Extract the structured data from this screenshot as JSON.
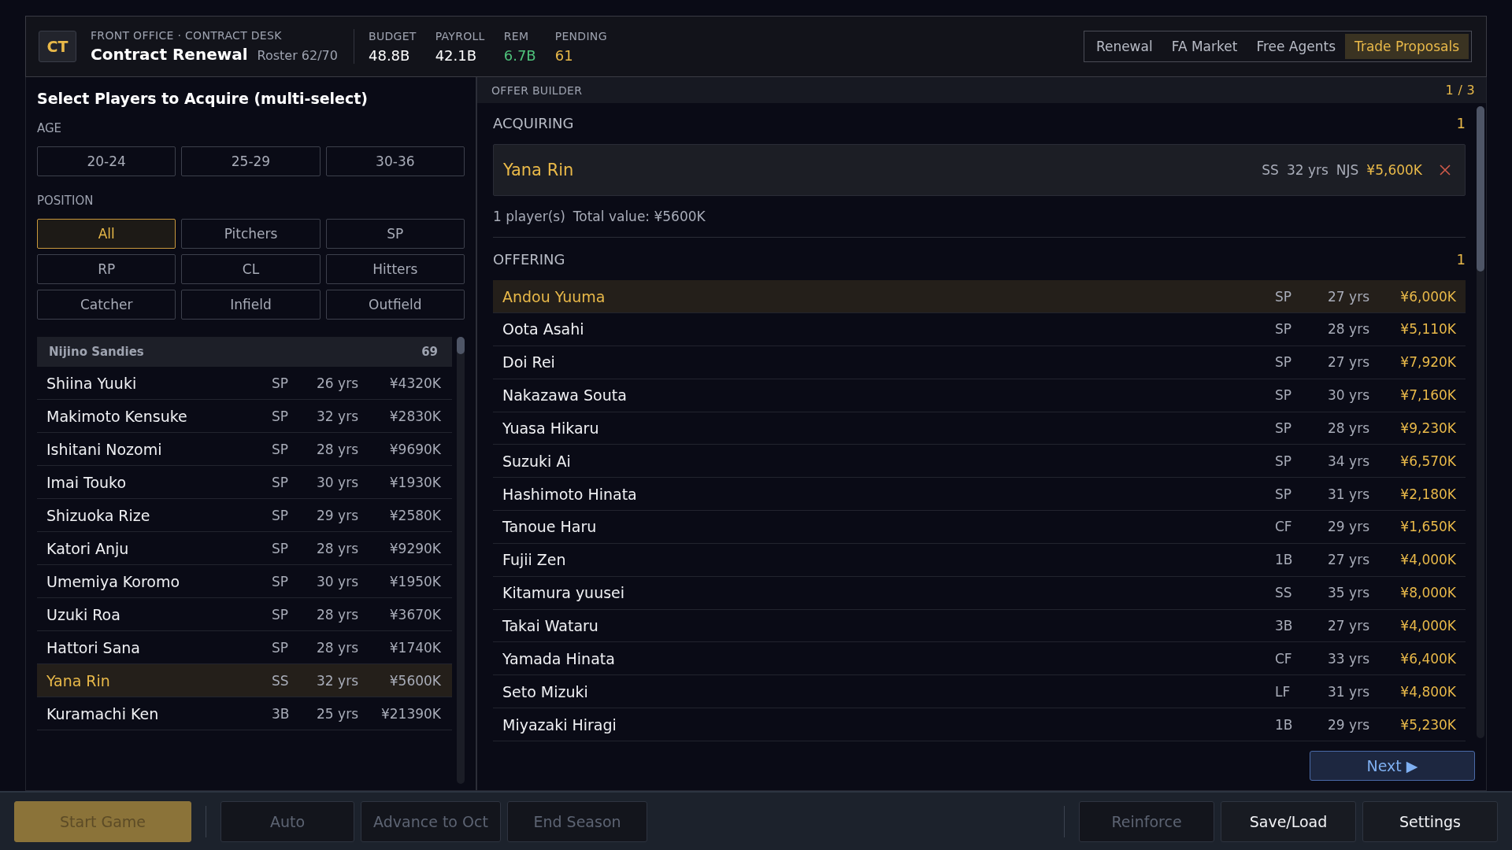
{
  "header": {
    "badge": "CT",
    "breadcrumb": "FRONT OFFICE · CONTRACT DESK",
    "title": "Contract Renewal",
    "roster": "Roster 62/70",
    "stats": [
      {
        "label": "BUDGET",
        "value": "48.8B",
        "color": "#ffffff"
      },
      {
        "label": "PAYROLL",
        "value": "42.1B",
        "color": "#ffffff"
      },
      {
        "label": "REM",
        "value": "6.7B",
        "color": "#4fc27b"
      },
      {
        "label": "PENDING",
        "value": "61",
        "color": "#e9b949"
      }
    ],
    "tabs": [
      {
        "label": "Renewal",
        "selected": false
      },
      {
        "label": "FA Market",
        "selected": false
      },
      {
        "label": "Free Agents",
        "selected": false
      },
      {
        "label": "Trade Proposals",
        "selected": true
      }
    ]
  },
  "selector": {
    "title": "Select Players to Acquire (multi-select)",
    "filters": [
      {
        "label": "AGE",
        "options": [
          {
            "label": "20-24",
            "selected": false
          },
          {
            "label": "25-29",
            "selected": false
          },
          {
            "label": "30-36",
            "selected": false
          }
        ]
      },
      {
        "label": "POSITION",
        "options": [
          {
            "label": "All",
            "selected": true
          },
          {
            "label": "Pitchers",
            "selected": false
          },
          {
            "label": "SP",
            "selected": false
          },
          {
            "label": "RP",
            "selected": false
          },
          {
            "label": "CL",
            "selected": false
          },
          {
            "label": "Hitters",
            "selected": false
          },
          {
            "label": "Catcher",
            "selected": false
          },
          {
            "label": "Infield",
            "selected": false
          },
          {
            "label": "Outfield",
            "selected": false
          }
        ]
      }
    ],
    "team": {
      "name": "Nijino Sandies",
      "count": "69"
    },
    "players": [
      {
        "name": "Shiina Yuuki",
        "pos": "SP",
        "age": "26 yrs",
        "value": "¥4320K",
        "selected": false
      },
      {
        "name": "Makimoto Kensuke",
        "pos": "SP",
        "age": "32 yrs",
        "value": "¥2830K",
        "selected": false
      },
      {
        "name": "Ishitani Nozomi",
        "pos": "SP",
        "age": "28 yrs",
        "value": "¥9690K",
        "selected": false
      },
      {
        "name": "Imai Touko",
        "pos": "SP",
        "age": "30 yrs",
        "value": "¥1930K",
        "selected": false
      },
      {
        "name": "Shizuoka Rize",
        "pos": "SP",
        "age": "29 yrs",
        "value": "¥2580K",
        "selected": false
      },
      {
        "name": "Katori Anju",
        "pos": "SP",
        "age": "28 yrs",
        "value": "¥9290K",
        "selected": false
      },
      {
        "name": "Umemiya Koromo",
        "pos": "SP",
        "age": "30 yrs",
        "value": "¥1950K",
        "selected": false
      },
      {
        "name": "Uzuki Roa",
        "pos": "SP",
        "age": "28 yrs",
        "value": "¥3670K",
        "selected": false
      },
      {
        "name": "Hattori Sana",
        "pos": "SP",
        "age": "28 yrs",
        "value": "¥1740K",
        "selected": false
      },
      {
        "name": "Yana Rin",
        "pos": "SS",
        "age": "32 yrs",
        "value": "¥5600K",
        "selected": true
      },
      {
        "name": "Kuramachi Ken",
        "pos": "3B",
        "age": "25 yrs",
        "value": "¥21390K",
        "selected": false
      }
    ]
  },
  "offer_builder": {
    "title": "OFFER BUILDER",
    "page": "1 / 3",
    "acquiring": {
      "label": "ACQUIRING",
      "count": "1",
      "items": [
        {
          "name": "Yana Rin",
          "pos": "SS",
          "age": "32 yrs",
          "team": "NJS",
          "value": "¥5,600K"
        }
      ],
      "count_text": "1 player(s)",
      "total": "Total value: ¥5600K"
    },
    "offering": {
      "label": "OFFERING",
      "count": "1",
      "players": [
        {
          "name": "Andou Yuuma",
          "pos": "SP",
          "age": "27 yrs",
          "value": "¥6,000K",
          "selected": true
        },
        {
          "name": "Oota Asahi",
          "pos": "SP",
          "age": "28 yrs",
          "value": "¥5,110K",
          "selected": false
        },
        {
          "name": "Doi Rei",
          "pos": "SP",
          "age": "27 yrs",
          "value": "¥7,920K",
          "selected": false
        },
        {
          "name": "Nakazawa Souta",
          "pos": "SP",
          "age": "30 yrs",
          "value": "¥7,160K",
          "selected": false
        },
        {
          "name": "Yuasa Hikaru",
          "pos": "SP",
          "age": "28 yrs",
          "value": "¥9,230K",
          "selected": false
        },
        {
          "name": "Suzuki Ai",
          "pos": "SP",
          "age": "34 yrs",
          "value": "¥6,570K",
          "selected": false
        },
        {
          "name": "Hashimoto Hinata",
          "pos": "SP",
          "age": "31 yrs",
          "value": "¥2,180K",
          "selected": false
        },
        {
          "name": "Tanoue Haru",
          "pos": "CF",
          "age": "29 yrs",
          "value": "¥1,650K",
          "selected": false
        },
        {
          "name": "Fujii Zen",
          "pos": "1B",
          "age": "27 yrs",
          "value": "¥4,000K",
          "selected": false
        },
        {
          "name": "Kitamura yuusei",
          "pos": "SS",
          "age": "35 yrs",
          "value": "¥8,000K",
          "selected": false
        },
        {
          "name": "Takai Wataru",
          "pos": "3B",
          "age": "27 yrs",
          "value": "¥4,000K",
          "selected": false
        },
        {
          "name": "Yamada Hinata",
          "pos": "CF",
          "age": "33 yrs",
          "value": "¥6,400K",
          "selected": false
        },
        {
          "name": "Seto Mizuki",
          "pos": "LF",
          "age": "31 yrs",
          "value": "¥4,800K",
          "selected": false
        },
        {
          "name": "Miyazaki Hiragi",
          "pos": "1B",
          "age": "29 yrs",
          "value": "¥5,230K",
          "selected": false
        }
      ]
    },
    "next": "Next ▶"
  },
  "bottom_bar": {
    "left": [
      {
        "label": "Start Game",
        "kind": "primary",
        "disabled": true
      },
      {
        "label": "Auto",
        "kind": "normal",
        "disabled": true
      },
      {
        "label": "Advance to Oct",
        "kind": "normal",
        "disabled": true
      },
      {
        "label": "End Season",
        "kind": "normal",
        "disabled": true
      }
    ],
    "right": [
      {
        "label": "Reinforce",
        "disabled": true
      },
      {
        "label": "Save/Load",
        "disabled": false
      },
      {
        "label": "Settings",
        "disabled": false
      }
    ]
  }
}
